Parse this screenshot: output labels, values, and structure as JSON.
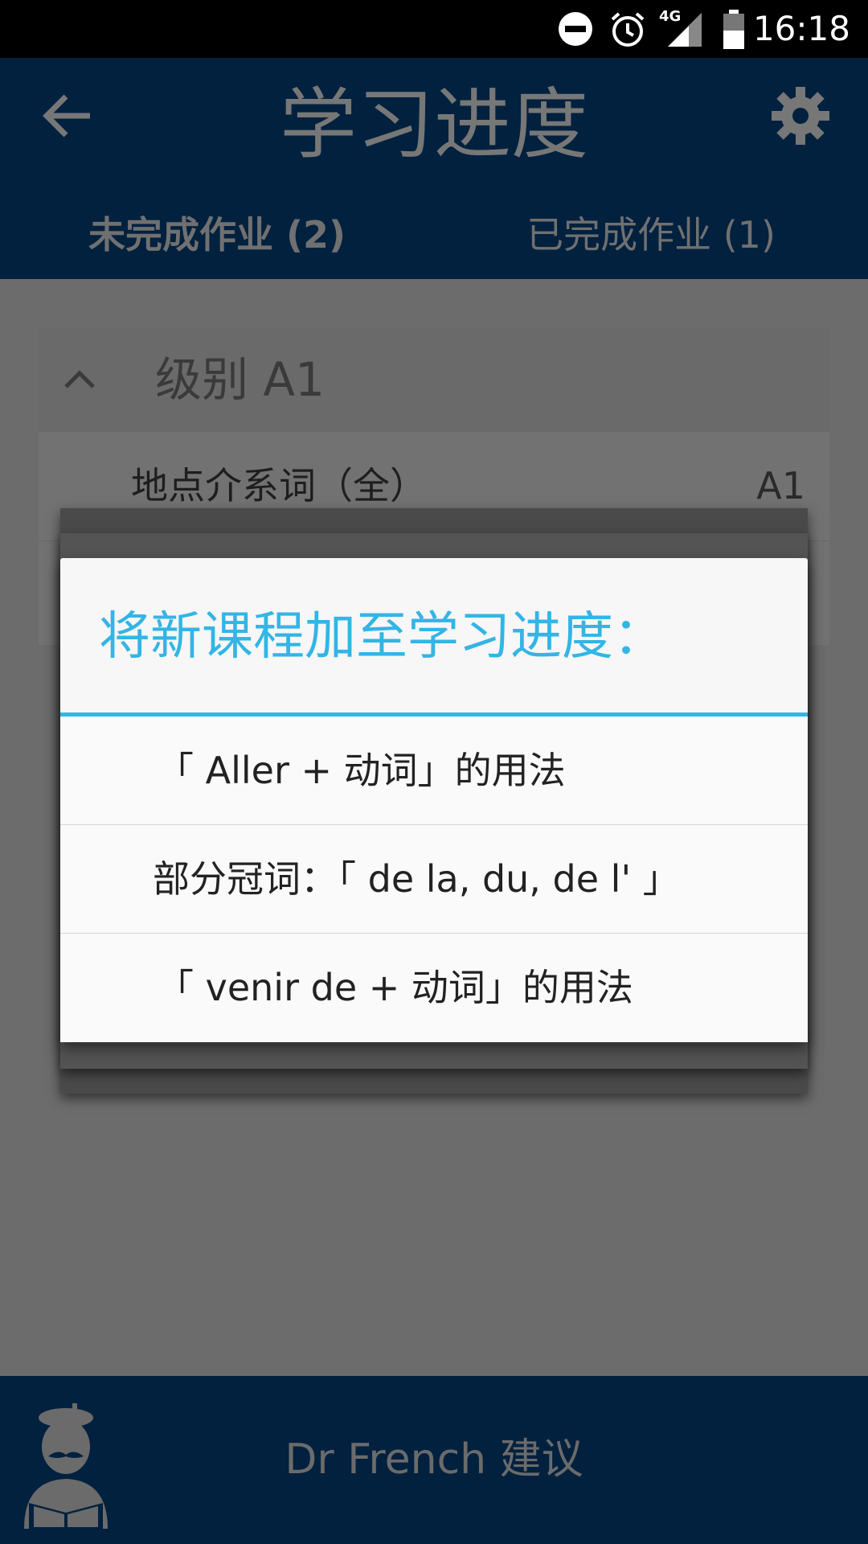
{
  "status_bar": {
    "time": "16:18",
    "network": "4G",
    "icons": [
      "do-not-disturb-icon",
      "alarm-icon",
      "signal-icon",
      "battery-icon"
    ]
  },
  "app_bar": {
    "title": "学习进度",
    "back_icon": "arrow-left-icon",
    "settings_icon": "gear-icon",
    "tabs": [
      {
        "label": "未完成作业 (2)",
        "active": true
      },
      {
        "label": "已完成作业 (1)",
        "active": false
      }
    ]
  },
  "content": {
    "level_section": {
      "title": "级别 A1",
      "expanded": true,
      "lessons": [
        {
          "title": "地点介系词（全）",
          "level": "A1"
        }
      ]
    }
  },
  "dialog": {
    "title": "将新课程加至学习进度：",
    "options": [
      "「 Aller + 动词」的用法",
      "部分冠词：「 de la, du, de l' 」",
      "「 venir de + 动词」的用法"
    ]
  },
  "bottom_bar": {
    "label": "Dr French 建议",
    "avatar_icon": "dr-french-avatar-icon"
  },
  "colors": {
    "app_bar": "#01213f",
    "accent": "#33b5e5",
    "scrim": "#6b6b6b"
  }
}
